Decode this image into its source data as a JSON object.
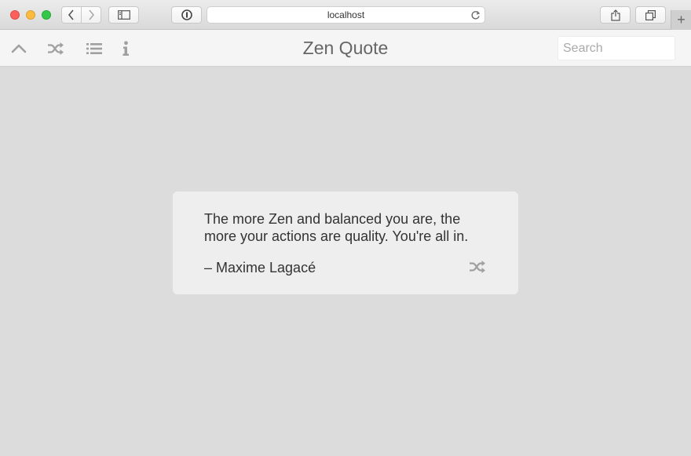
{
  "browser": {
    "url": "localhost",
    "icons": [
      "back-icon",
      "forward-icon",
      "sidebar-icon",
      "password-icon",
      "reload-icon",
      "share-icon",
      "tabs-icon",
      "plus-icon"
    ],
    "new_tab_glyph": "+"
  },
  "toolbar": {
    "title": "Zen Quote",
    "search_placeholder": "Search",
    "icons": [
      "chevron-up-icon",
      "shuffle-icon",
      "list-icon",
      "info-icon"
    ]
  },
  "quote": {
    "text": "The more Zen and balanced you are, the more your actions are quality. You're all in.",
    "author": "– Maxime Lagacé"
  },
  "colors": {
    "background": "#dcdcdc",
    "toolbar": "#f5f5f5",
    "card": "#eeeeee",
    "icon": "#a0a0a0"
  }
}
